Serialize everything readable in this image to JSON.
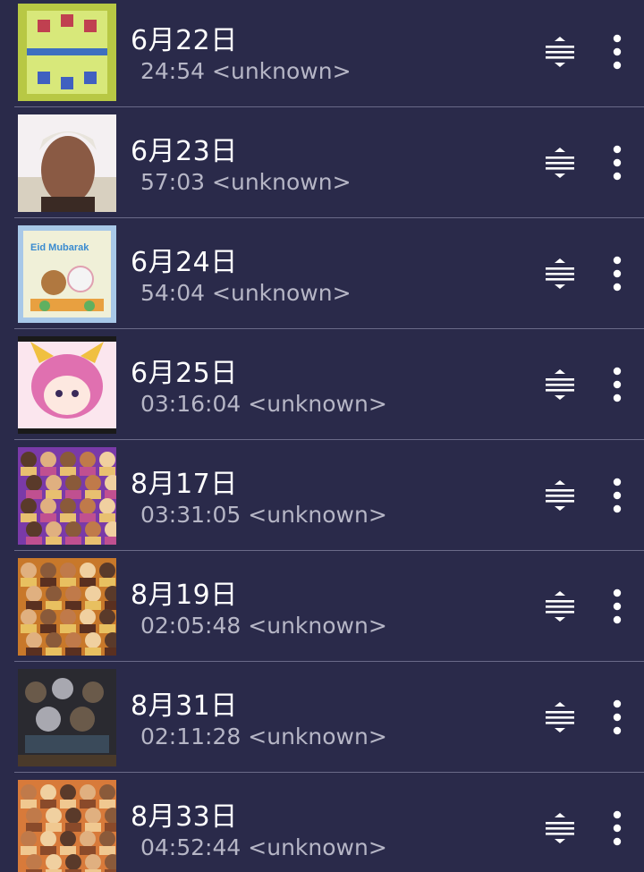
{
  "items": [
    {
      "title": "6月22日",
      "duration": "24:54",
      "artist": "<unknown>",
      "thumb_icon": "game-arena-thumbnail",
      "thumb_colors": [
        "#b8c844",
        "#3d6fbf",
        "#d8e87a"
      ]
    },
    {
      "title": "6月23日",
      "duration": "57:03",
      "artist": "<unknown>",
      "thumb_icon": "portrait-thumbnail",
      "thumb_colors": [
        "#f4f0f2",
        "#8a5a44",
        "#d8d0c0"
      ]
    },
    {
      "title": "6月24日",
      "duration": "54:04",
      "artist": "<unknown>",
      "thumb_icon": "eid-card-thumbnail",
      "thumb_colors": [
        "#f0f0d8",
        "#3a8bd0",
        "#e8a040"
      ],
      "thumb_text": "Eid Mubarak"
    },
    {
      "title": "6月25日",
      "duration": "03:16:04",
      "artist": "<unknown>",
      "thumb_icon": "anime-character-thumbnail",
      "thumb_colors": [
        "#fbe6ee",
        "#e070b0",
        "#f0c040"
      ]
    },
    {
      "title": "8月17日",
      "duration": "03:31:05",
      "artist": "<unknown>",
      "thumb_icon": "wrestlers-collage-thumbnail",
      "thumb_colors": [
        "#7a3aa8",
        "#c05090",
        "#e8c070"
      ]
    },
    {
      "title": "8月19日",
      "duration": "02:05:48",
      "artist": "<unknown>",
      "thumb_icon": "wrestlers-collage-thumbnail",
      "thumb_colors": [
        "#c8782a",
        "#5a3020",
        "#e8c060"
      ]
    },
    {
      "title": "8月31日",
      "duration": "02:11:28",
      "artist": "<unknown>",
      "thumb_icon": "wrestlers-poster-thumbnail",
      "thumb_colors": [
        "#2a2a30",
        "#6a5a4a",
        "#a8a8b0"
      ]
    },
    {
      "title": "8月33日",
      "duration": "04:52:44",
      "artist": "<unknown>",
      "thumb_icon": "wrestlers-collage-thumbnail",
      "thumb_colors": [
        "#d87a3a",
        "#8a4a2a",
        "#f0c890"
      ]
    }
  ],
  "row_icons": {
    "reorder": "drag-handle-icon",
    "menu": "more-vertical-icon"
  },
  "colors": {
    "background": "#2a2a4a",
    "divider": "#6a6a88",
    "title": "#ffffff",
    "subtitle": "#b6b6c6"
  }
}
